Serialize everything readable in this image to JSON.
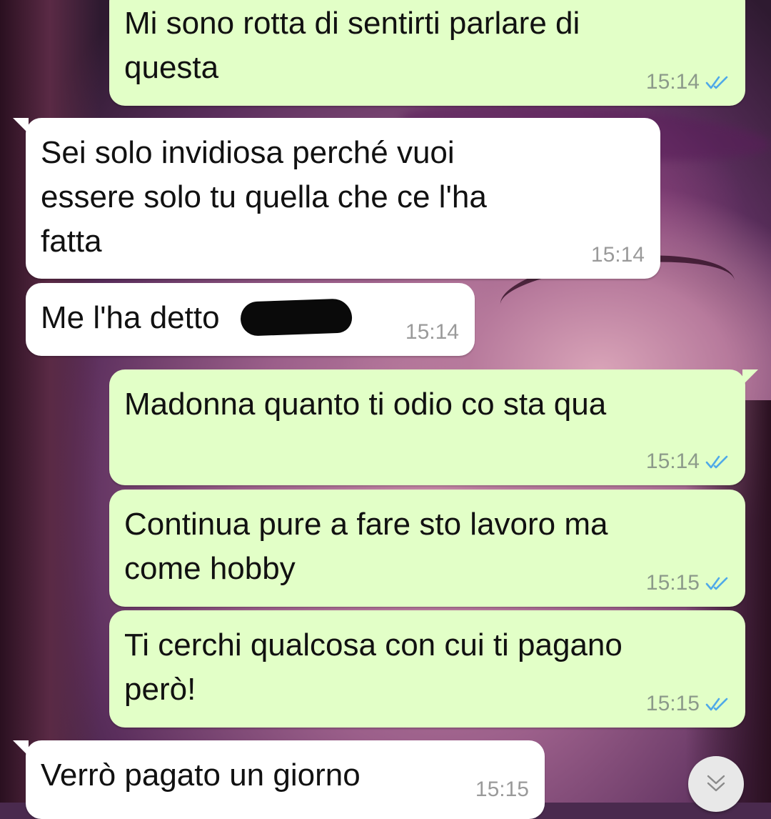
{
  "messages": [
    {
      "direction": "out",
      "text": "Mi sono rotta di sentirti parlare di\nquesta",
      "time": "15:14",
      "status": "read"
    },
    {
      "direction": "in",
      "text": "Sei solo invidiosa perché vuoi\nessere solo tu quella che ce l'ha\nfatta",
      "time": "15:14"
    },
    {
      "direction": "in",
      "text": "Me l'ha detto",
      "time": "15:14"
    },
    {
      "direction": "out",
      "text": "Madonna quanto ti odio co sta qua",
      "time": "15:14",
      "status": "read"
    },
    {
      "direction": "out",
      "text": "Continua pure a fare sto lavoro ma\ncome hobby",
      "time": "15:15",
      "status": "read"
    },
    {
      "direction": "out",
      "text": "Ti cerchi qualcosa con cui ti pagano\nperò!",
      "time": "15:15",
      "status": "read"
    },
    {
      "direction": "in",
      "text": "Verrò pagato un giorno",
      "time": "15:15"
    }
  ],
  "colors": {
    "outgoing_bubble": "#e2ffc7",
    "incoming_bubble": "#ffffff",
    "read_ticks": "#4fa9e8"
  },
  "icons": {
    "read_status": "double-check-icon",
    "scroll_down": "double-chevron-down-icon"
  }
}
